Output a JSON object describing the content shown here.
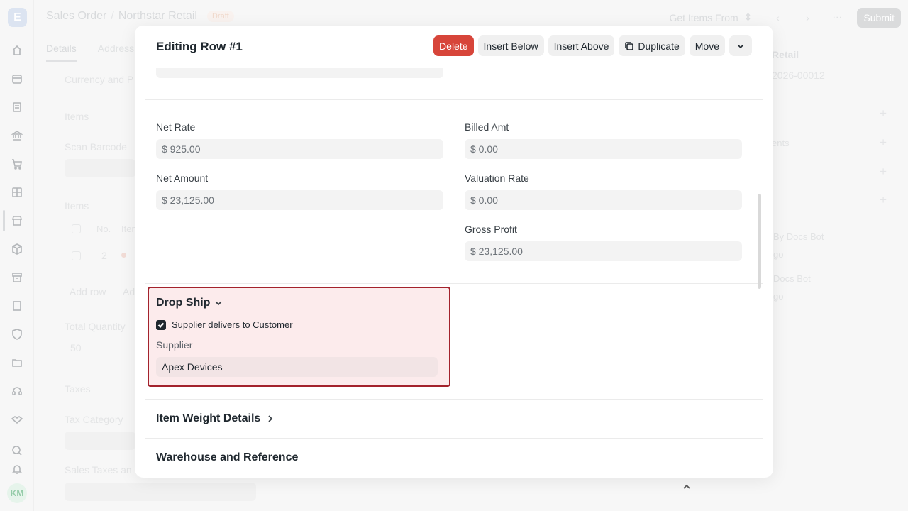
{
  "app": {
    "logo_letter": "E",
    "avatar_initials": "KM"
  },
  "topbar": {
    "breadcrumb_root": "Sales Order",
    "breadcrumb_current": "Northstar Retail",
    "status_badge": "Draft",
    "get_items_label": "Get Items From",
    "submit_label": "Submit"
  },
  "background": {
    "tabs": [
      "Details",
      "Address"
    ],
    "left_labels": {
      "currency": "Currency and P",
      "items_heading": "Items",
      "scan_barcode": "Scan Barcode",
      "items_table": "Items",
      "col_no": "No.",
      "col_item": "Iten",
      "row_no": "2",
      "add_row": "Add row",
      "add_other": "Ad",
      "total_quantity": "Total Quantity",
      "total_quantity_value": "50",
      "taxes": "Taxes",
      "tax_category": "Tax Category",
      "sales_taxes": "Sales Taxes an"
    },
    "right_labels": {
      "title": "Retail",
      "id": "2026-00012",
      "attachments": "ents",
      "activity_1_by": "By Docs Bot",
      "activity_1_time": "go",
      "activity_2_by": "Docs Bot",
      "activity_2_time": "go"
    }
  },
  "modal": {
    "title": "Editing Row #1",
    "actions": {
      "delete": "Delete",
      "insert_below": "Insert Below",
      "insert_above": "Insert Above",
      "duplicate": "Duplicate",
      "move": "Move"
    },
    "fields": {
      "net_rate_label": "Net Rate",
      "net_rate_value": "$ 925.00",
      "net_amount_label": "Net Amount",
      "net_amount_value": "$ 23,125.00",
      "billed_amt_label": "Billed Amt",
      "billed_amt_value": "$ 0.00",
      "valuation_rate_label": "Valuation Rate",
      "valuation_rate_value": "$ 0.00",
      "gross_profit_label": "Gross Profit",
      "gross_profit_value": "$ 23,125.00"
    },
    "drop_ship": {
      "title": "Drop Ship",
      "checkbox_label": "Supplier delivers to Customer",
      "checkbox_checked": true,
      "supplier_label": "Supplier",
      "supplier_value": "Apex Devices"
    },
    "sections": {
      "item_weight": "Item Weight Details",
      "warehouse": "Warehouse and Reference"
    }
  },
  "colors": {
    "danger": "#d7453a",
    "highlight_border": "#a3222c",
    "highlight_bg": "#fcebec"
  }
}
